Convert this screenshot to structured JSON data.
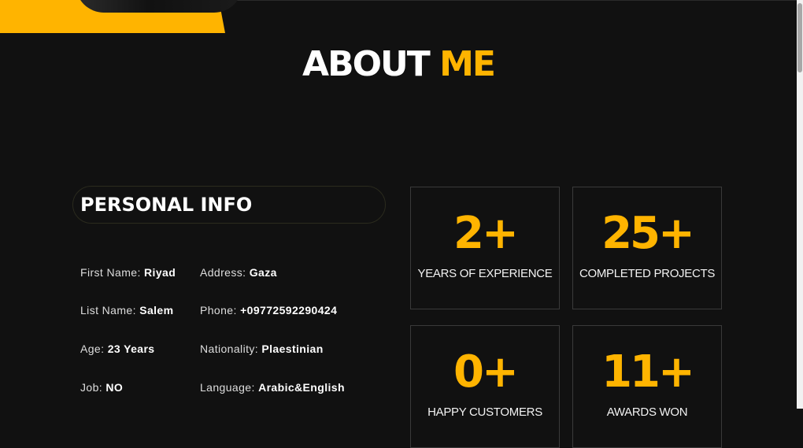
{
  "heading": {
    "main": "ABOUT",
    "accent": "ME"
  },
  "personal_info": {
    "title": "PERSONAL INFO",
    "fields": [
      {
        "label": "First Name:",
        "value": "Riyad"
      },
      {
        "label": "Address:",
        "value": "Gaza"
      },
      {
        "label": "List Name:",
        "value": "Salem"
      },
      {
        "label": "Phone:",
        "value": "+09772592290424"
      },
      {
        "label": "Age:",
        "value": "23 Years"
      },
      {
        "label": "Nationality:",
        "value": "Plaestinian"
      },
      {
        "label": "Job:",
        "value": "NO"
      },
      {
        "label": "Language:",
        "value": "Arabic&English"
      }
    ]
  },
  "stats": [
    {
      "number": "2+",
      "label": "YEARS OF EXPERIENCE"
    },
    {
      "number": "25+",
      "label": "COMPLETED PROJECTS"
    },
    {
      "number": "0+",
      "label": "HAPPY CUSTOMERS"
    },
    {
      "number": "11+",
      "label": "AWARDS WON"
    }
  ],
  "colors": {
    "accent": "#ffb400",
    "background": "#111111",
    "text": "#ffffff"
  }
}
